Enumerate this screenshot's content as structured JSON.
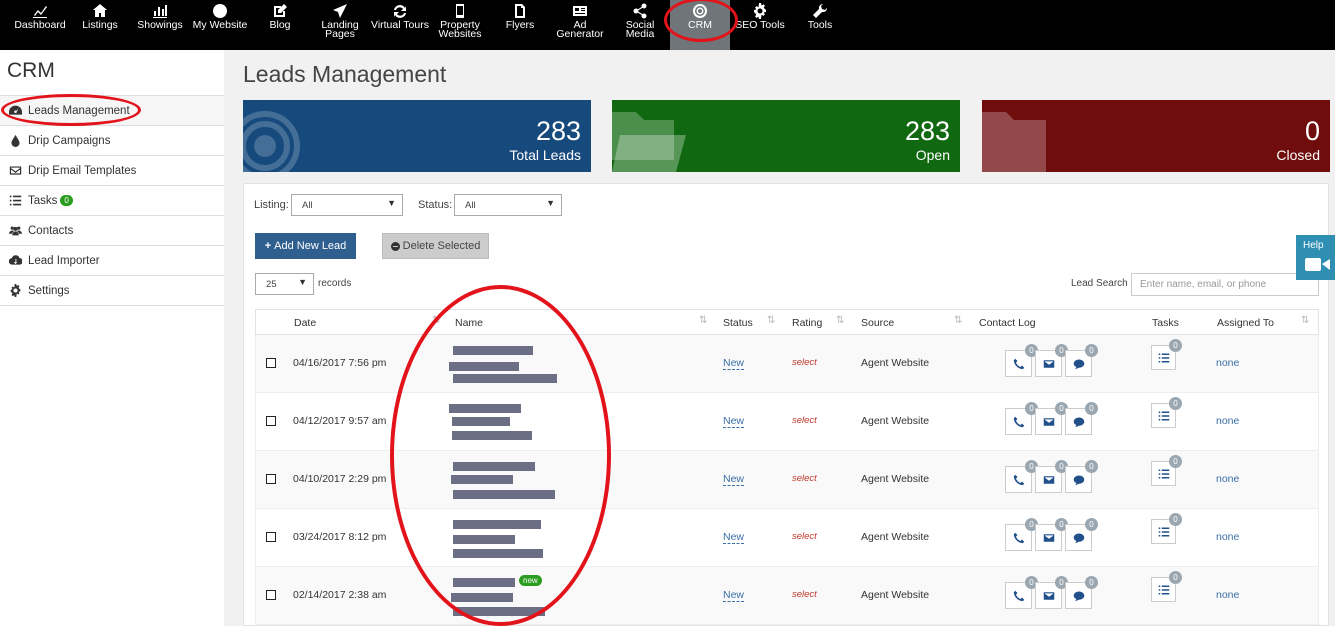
{
  "nav": {
    "items": [
      {
        "label": "Dashboard",
        "icon": "chart-icon"
      },
      {
        "label": "Listings",
        "icon": "home-icon"
      },
      {
        "label": "Showings",
        "icon": "bar-chart-icon"
      },
      {
        "label": "My Website",
        "icon": "globe-icon"
      },
      {
        "label": "Blog",
        "icon": "edit-icon"
      },
      {
        "label": "Landing Pages",
        "icon": "send-icon"
      },
      {
        "label": "Virtual Tours",
        "icon": "refresh-icon"
      },
      {
        "label": "Property Websites",
        "icon": "mobile-icon"
      },
      {
        "label": "Flyers",
        "icon": "file-icon"
      },
      {
        "label": "Ad Generator",
        "icon": "newspaper-icon"
      },
      {
        "label": "Social Media",
        "icon": "share-icon"
      },
      {
        "label": "CRM",
        "icon": "target-icon",
        "active": true
      },
      {
        "label": "SEO Tools",
        "icon": "gear-icon"
      },
      {
        "label": "Tools",
        "icon": "wrench-icon"
      }
    ]
  },
  "sidebar": {
    "title": "CRM",
    "items": [
      {
        "label": "Leads Management",
        "icon": "dashboard-icon"
      },
      {
        "label": "Drip Campaigns",
        "icon": "drop-icon"
      },
      {
        "label": "Drip Email Templates",
        "icon": "envelope-icon"
      },
      {
        "label": "Tasks",
        "icon": "list-icon",
        "badge": "0"
      },
      {
        "label": "Contacts",
        "icon": "users-icon"
      },
      {
        "label": "Lead Importer",
        "icon": "cloud-download-icon"
      },
      {
        "label": "Settings",
        "icon": "gear-icon"
      }
    ]
  },
  "main": {
    "title": "Leads Management",
    "stats": [
      {
        "num": "283",
        "label": "Total Leads",
        "color": "#174a7c"
      },
      {
        "num": "283",
        "label": "Open",
        "color": "#106910"
      },
      {
        "num": "0",
        "label": "Closed",
        "color": "#6f0d0d"
      }
    ],
    "filters": {
      "listing_label": "Listing:",
      "listing_value": "All",
      "status_label": "Status:",
      "status_value": "All"
    },
    "add_button": "Add New Lead",
    "delete_button": "Delete Selected",
    "records_value": "25",
    "records_label": "records",
    "search_label": "Lead Search",
    "search_placeholder": "Enter name, email, or phone",
    "columns": [
      "Date",
      "Name",
      "Status",
      "Rating",
      "Source",
      "Contact Log",
      "Tasks",
      "Assigned To"
    ],
    "rows": [
      {
        "date": "04/16/2017 7:56 pm",
        "status": "New",
        "rating": "select",
        "source": "Agent Website",
        "calls": "0",
        "emails": "0",
        "texts": "0",
        "tasks": "0",
        "assigned": "none"
      },
      {
        "date": "04/12/2017 9:57 am",
        "status": "New",
        "rating": "select",
        "source": "Agent Website",
        "calls": "0",
        "emails": "0",
        "texts": "0",
        "tasks": "0",
        "assigned": "none"
      },
      {
        "date": "04/10/2017 2:29 pm",
        "status": "New",
        "rating": "select",
        "source": "Agent Website",
        "calls": "0",
        "emails": "0",
        "texts": "0",
        "tasks": "0",
        "assigned": "none"
      },
      {
        "date": "03/24/2017 8:12 pm",
        "status": "New",
        "rating": "select",
        "source": "Agent Website",
        "calls": "0",
        "emails": "0",
        "texts": "0",
        "tasks": "0",
        "assigned": "none"
      },
      {
        "date": "02/14/2017 2:38 am",
        "status": "New",
        "rating": "select",
        "source": "Agent Website",
        "calls": "0",
        "emails": "0",
        "texts": "0",
        "tasks": "0",
        "assigned": "none",
        "badge": "new"
      }
    ]
  },
  "help": {
    "label": "Help"
  },
  "colors": {
    "accent": "#2f5f8f",
    "annotation": "#e3131b"
  }
}
